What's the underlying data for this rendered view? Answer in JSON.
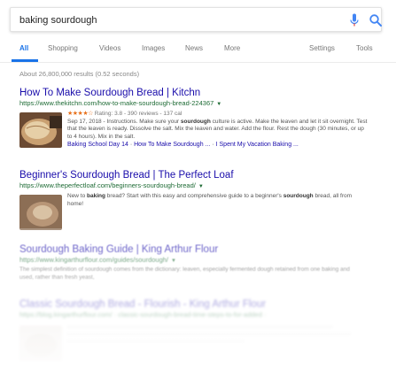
{
  "search": {
    "value": "baking sourdough"
  },
  "tabs": [
    {
      "label": "All"
    },
    {
      "label": "Shopping"
    },
    {
      "label": "Videos"
    },
    {
      "label": "Images"
    },
    {
      "label": "News"
    },
    {
      "label": "More"
    },
    {
      "label": "Settings"
    },
    {
      "label": "Tools"
    }
  ],
  "stats": "About 26,800,000 results (0.52 seconds)",
  "results": [
    {
      "title": "How To Make Sourdough Bread | Kitchn",
      "url": "https://www.thekitchn.com/how-to-make-sourdough-bread-224367",
      "stars": "★★★★☆",
      "rating": "Rating: 3.8 - 390 reviews - 137 cal",
      "snippet_pre": "Sep 17, 2018 - Instructions. Make sure your ",
      "snippet_bold": "sourdough",
      "snippet_post": " culture is active. Make the leaven and let it sit overnight. Test that the leaven is ready. Dissolve the salt. Mix the leaven and water. Add the flour. Rest the dough (30 minutes, or up to 4 hours). Mix in the salt.",
      "sitelink1": "Baking School Day 14",
      "sitelink_sep": " · ",
      "sitelink2": "How To Make Sourdough ...",
      "sitelink3": "I Spent My Vacation Baking ..."
    },
    {
      "title": "Beginner's Sourdough Bread | The Perfect Loaf",
      "url": "https://www.theperfectloaf.com/beginners-sourdough-bread/",
      "snippet_pre": "New to ",
      "snippet_bold": "baking",
      "snippet_mid": " bread? Start with this easy and comprehensive guide to a beginner's ",
      "snippet_bold2": "sourdough",
      "snippet_post": " bread, all from home!"
    },
    {
      "title": "Sourdough Baking Guide | King Arthur Flour",
      "url": "https://www.kingarthurflour.com/guides/sourdough/",
      "snippet": "The simplest definition of sourdough comes from the dictionary: leaven, especially fermented dough retained from one baking and used, rather than fresh yeast,"
    },
    {
      "title": "Classic Sourdough Bread - Flourish - King Arthur Flour",
      "url": "https://blog.kingarthurflour.com/ · classic-sourdough-bread-time-steps-to-for-added ·"
    }
  ],
  "colors": {
    "link": "#1a0dab",
    "url": "#1e6b35",
    "accent": "#1a73e8",
    "mic_blue": "#4285f4",
    "mic_red": "#ea4335",
    "star": "#e7711b"
  },
  "icons": {
    "mic": "microphone-icon",
    "search": "search-icon",
    "caret": "caret-down-icon"
  }
}
